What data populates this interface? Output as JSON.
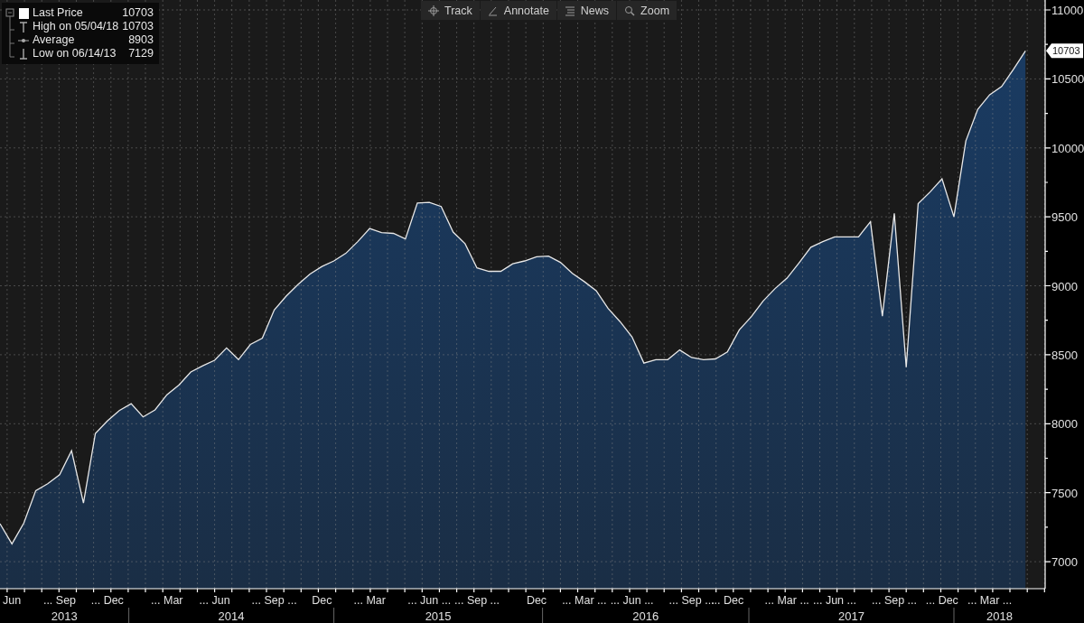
{
  "legend": [
    {
      "kind": "last",
      "label": "Last Price",
      "value": "10703"
    },
    {
      "kind": "high",
      "label": "High on 05/04/18",
      "value": "10703"
    },
    {
      "kind": "average",
      "label": "Average",
      "value": "8903"
    },
    {
      "kind": "low",
      "label": "Low on 06/14/13",
      "value": "7129"
    }
  ],
  "toolbar": [
    {
      "kind": "track",
      "label": "Track"
    },
    {
      "kind": "annotate",
      "label": "Annotate"
    },
    {
      "kind": "news",
      "label": "News"
    },
    {
      "kind": "zoom",
      "label": "Zoom"
    }
  ],
  "chart": {
    "last_price_tag": "10703",
    "year_bands": [
      {
        "label": "2013"
      },
      {
        "label": "2014"
      },
      {
        "label": "2015"
      },
      {
        "label": "2016"
      },
      {
        "label": "2017"
      },
      {
        "label": "2018"
      }
    ],
    "chart_data": {
      "type": "area",
      "grid": true,
      "ylim": [
        6804,
        11072
      ],
      "categories": [
        null,
        "Jun",
        null,
        null,
        null,
        "... Sep",
        null,
        null,
        null,
        "... Dec",
        null,
        null,
        null,
        null,
        "... Mar",
        null,
        null,
        null,
        "... Jun",
        null,
        null,
        null,
        null,
        "... Sep ...",
        null,
        null,
        null,
        "Dec",
        null,
        null,
        null,
        "... Mar",
        null,
        null,
        null,
        null,
        "... Jun ...",
        null,
        null,
        null,
        "... Sep ...",
        null,
        null,
        null,
        null,
        "Dec",
        null,
        null,
        null,
        "... Mar ...",
        null,
        null,
        null,
        "... Jun ...",
        null,
        null,
        null,
        null,
        "... Sep ...",
        null,
        null,
        "... Dec",
        null,
        null,
        null,
        null,
        "... Mar ...",
        null,
        null,
        null,
        "... Jun ...",
        null,
        null,
        null,
        null,
        "... Sep ...",
        null,
        null,
        null,
        "... Dec",
        null,
        null,
        null,
        "... Mar ...",
        null,
        null,
        null
      ],
      "series": [
        {
          "color": "#1a3b62",
          "values": [
            7275,
            7129,
            7280,
            7515,
            7565,
            7630,
            7805,
            7425,
            7930,
            8020,
            8095,
            8145,
            8050,
            8100,
            8210,
            8280,
            8375,
            8420,
            8460,
            8550,
            8465,
            8575,
            8620,
            8825,
            8925,
            9010,
            9085,
            9140,
            9180,
            9235,
            9320,
            9415,
            9385,
            9380,
            9340,
            9600,
            9605,
            9575,
            9390,
            9305,
            9130,
            9105,
            9105,
            9160,
            9180,
            9210,
            9215,
            9170,
            9090,
            9030,
            8965,
            8835,
            8740,
            8630,
            8440,
            8465,
            8465,
            8535,
            8480,
            8465,
            8470,
            8520,
            8680,
            8775,
            8890,
            8980,
            9055,
            9165,
            9280,
            9320,
            9355,
            9355,
            9355,
            9465,
            8780,
            9525,
            8410,
            9595,
            9680,
            9775,
            9500,
            10050,
            10280,
            10385,
            10445,
            10570,
            10703
          ]
        }
      ],
      "yticks": [
        7000,
        7500,
        8000,
        8500,
        9000,
        9500,
        10000,
        10500,
        11000
      ]
    }
  }
}
